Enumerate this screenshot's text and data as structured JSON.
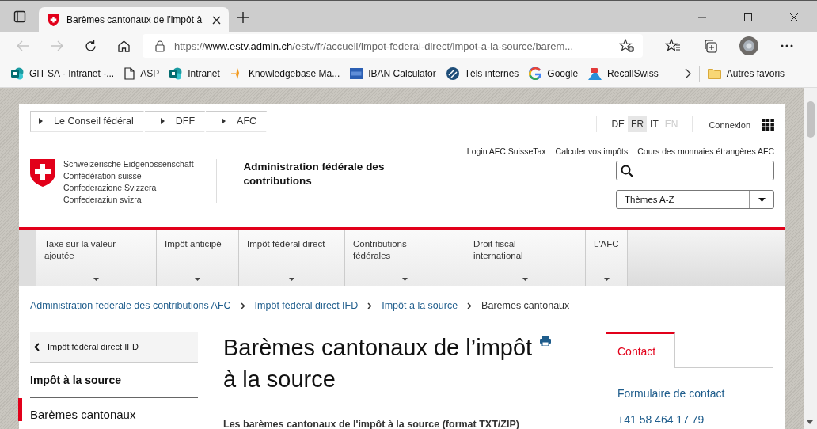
{
  "browser": {
    "tab": {
      "title": "Barèmes cantonaux de l'impôt à",
      "selected": true
    },
    "url": {
      "scheme": "https://",
      "host": "www.estv.admin.ch",
      "path": "/estv/fr/accueil/impot-federal-direct/impot-a-la-source/barem..."
    },
    "bookmarks": [
      {
        "label": "GIT SA - Intranet -...",
        "kind": "sharepoint"
      },
      {
        "label": "ASP",
        "kind": "page"
      },
      {
        "label": "Intranet",
        "kind": "sharepoint"
      },
      {
        "label": "Knowledgebase Ma...",
        "kind": "spark"
      },
      {
        "label": "IBAN Calculator",
        "kind": "iban"
      },
      {
        "label": "Téls internes",
        "kind": "globe"
      },
      {
        "label": "Google",
        "kind": "google"
      },
      {
        "label": "RecallSwiss",
        "kind": "recall"
      }
    ],
    "other_favorites": "Autres favoris"
  },
  "page": {
    "federal_links": [
      "Le Conseil fédéral",
      "DFF",
      "AFC"
    ],
    "languages": [
      {
        "label": "DE",
        "selected": false,
        "disabled": false
      },
      {
        "label": "FR",
        "selected": true,
        "disabled": false
      },
      {
        "label": "IT",
        "selected": false,
        "disabled": false
      },
      {
        "label": "EN",
        "selected": false,
        "disabled": true
      }
    ],
    "login": "Connexion",
    "confederation": [
      "Schweizerische Eidgenossenschaft",
      "Confédération suisse",
      "Confederazione Svizzera",
      "Confederaziun svizra"
    ],
    "department": "Administration fédérale des contributions",
    "service_links": [
      "Login AFC SuisseTax",
      "Calculer vos impôts",
      "Cours des monnaies étrangères AFC"
    ],
    "themes_select": "Thèmes A-Z",
    "nav": [
      "Taxe sur la valeur ajoutée",
      "Impôt anticipé",
      "Impôt fédéral direct",
      "Contributions fédérales",
      "Droit fiscal international",
      "L'AFC"
    ],
    "breadcrumbs": [
      "Administration fédérale des contributions AFC",
      "Impôt fédéral direct IFD",
      "Impôt à la source",
      "Barèmes cantonaux"
    ],
    "sidebar": {
      "back": "Impôt fédéral direct IFD",
      "section": "Impôt à la source",
      "items": [
        {
          "label": "Barèmes cantonaux",
          "selected": true
        }
      ]
    },
    "title": "Barèmes cantonaux de l’impôt à la source",
    "intro": "Les barèmes cantonaux de l'impôt à la source (format TXT/ZIP)",
    "contact": {
      "tab": "Contact",
      "form_link": "Formulaire de contact",
      "phone": "+41 58 464 17 79"
    }
  }
}
